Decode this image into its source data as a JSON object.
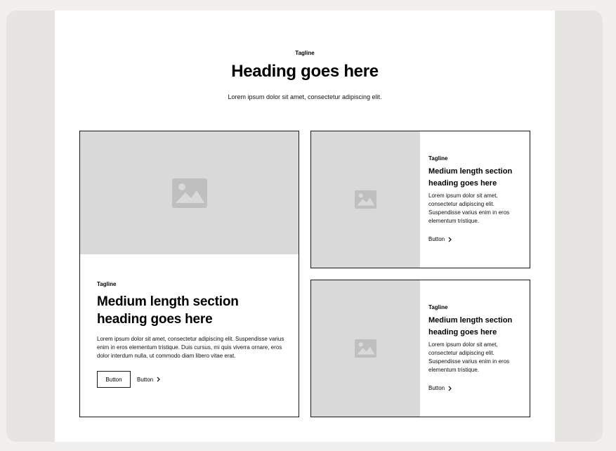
{
  "header": {
    "tagline": "Tagline",
    "heading": "Heading goes here",
    "subtext": "Lorem ipsum dolor sit amet, consectetur adipiscing elit."
  },
  "cards": [
    {
      "tagline": "Tagline",
      "heading": "Medium length section heading goes here",
      "body": "Lorem ipsum dolor sit amet, consectetur adipiscing elit. Suspendisse varius enim in eros elementum tristique. Duis cursus, mi quis viverra ornare, eros dolor interdum nulla, ut commodo diam libero vitae erat.",
      "primary_button": "Button",
      "link_button": "Button",
      "image_icon": "image-icon"
    },
    {
      "tagline": "Tagline",
      "heading": "Medium length section heading goes here",
      "body": "Lorem ipsum dolor sit amet, consectetur adipiscing elit. Suspendisse varius enim in eros elementum tristique.",
      "link_button": "Button",
      "image_icon": "image-icon"
    },
    {
      "tagline": "Tagline",
      "heading": "Medium length section heading goes here",
      "body": "Lorem ipsum dolor sit amet, consectetur adipiscing elit. Suspendisse varius enim in eros elementum tristique.",
      "link_button": "Button",
      "image_icon": "image-icon"
    }
  ],
  "colors": {
    "outer_background": "#f1f0ee",
    "frame_background": "#e6e5e2",
    "placeholder": "#d9d9d9",
    "placeholder_icon": "#bfbfbf",
    "border": "#1a1a1a"
  }
}
